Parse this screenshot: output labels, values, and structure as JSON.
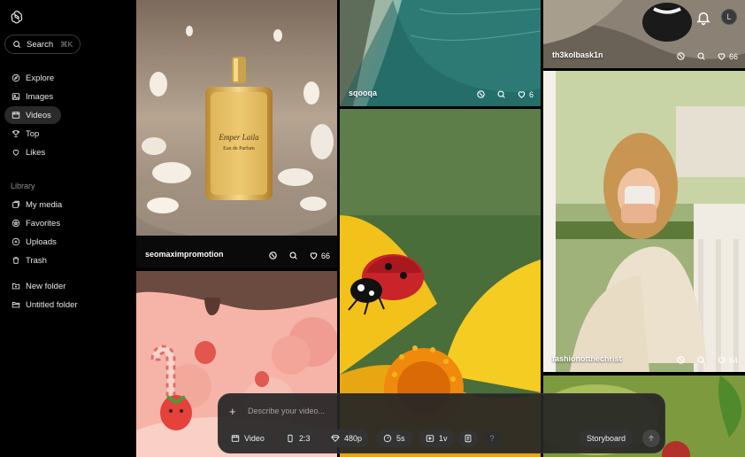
{
  "sidebar": {
    "search_label": "Search",
    "search_shortcut": "⌘K",
    "nav": [
      {
        "label": "Explore",
        "icon": "compass-icon"
      },
      {
        "label": "Images",
        "icon": "image-icon"
      },
      {
        "label": "Videos",
        "icon": "video-icon",
        "active": true
      },
      {
        "label": "Top",
        "icon": "trophy-icon"
      },
      {
        "label": "Likes",
        "icon": "heart-icon"
      }
    ],
    "library_label": "Library",
    "library": [
      {
        "label": "My media",
        "icon": "media-icon"
      },
      {
        "label": "Favorites",
        "icon": "star-icon"
      },
      {
        "label": "Uploads",
        "icon": "upload-icon"
      },
      {
        "label": "Trash",
        "icon": "trash-icon"
      }
    ],
    "folders": [
      {
        "label": "New folder",
        "icon": "new-folder-icon"
      },
      {
        "label": "Untitled folder",
        "icon": "folder-icon"
      }
    ]
  },
  "header": {
    "avatar_initial": "L"
  },
  "tiles": [
    {
      "caption": "seomaximpromotion",
      "likes": "66"
    },
    {
      "caption": "sqooqa",
      "likes": "6"
    },
    {
      "caption": "th3kolbask1n",
      "likes": "66"
    },
    {
      "caption": "fashionofthechrist",
      "likes": "64"
    }
  ],
  "composer": {
    "placeholder": "Describe your video...",
    "type_label": "Video",
    "aspect_label": "2:3",
    "resolution_label": "480p",
    "duration_label": "5s",
    "variations_label": "1v",
    "help_label": "?",
    "storyboard_label": "Storyboard"
  }
}
